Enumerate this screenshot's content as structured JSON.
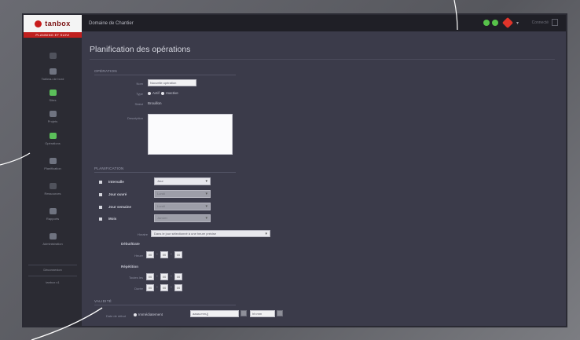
{
  "brand": {
    "logo_text": "tanbox",
    "tagline": "PLANNING ET SUIVI"
  },
  "topbar": {
    "app_title": "Domaine de Chantier",
    "user_name": "Connecté",
    "status_caret": "▾"
  },
  "sidebar": {
    "items": [
      {
        "label": "Tableau de bord",
        "icon": "dashboard-icon"
      },
      {
        "label": "Sites",
        "icon": "site-icon"
      },
      {
        "label": "Projets",
        "icon": "projects-icon"
      },
      {
        "label": "Opérations",
        "icon": "operations-icon"
      },
      {
        "label": "Planification",
        "icon": "planning-icon"
      },
      {
        "label": "Ressources",
        "icon": "resources-icon"
      },
      {
        "label": "Rapports",
        "icon": "reports-icon"
      },
      {
        "label": "Administration",
        "icon": "admin-icon"
      },
      {
        "label": "Déconnexion",
        "icon": "logout-icon"
      }
    ],
    "footer": "tanbox v1"
  },
  "page": {
    "title": "Planification des opérations",
    "section_operation": {
      "heading": "OPÉRATION",
      "name_label": "Nom",
      "name_value": "Nouvelle opération",
      "type_label": "Type",
      "type_options": [
        "Actif",
        "Inactive"
      ],
      "status_label": "Statut",
      "status_value": "Brouillon",
      "description_label": "Description",
      "description_value": ""
    },
    "section_schedule": {
      "heading": "PLANIFICATION",
      "rows": [
        {
          "label": "Intervalle",
          "value": "Jour",
          "disabled": false
        },
        {
          "label": "Jour ouvré",
          "value": "Lundi",
          "disabled": true
        },
        {
          "label": "Jour semaine",
          "value": "Lundi",
          "disabled": true
        },
        {
          "label": "Mois",
          "value": "Janvier",
          "disabled": true
        }
      ],
      "time_label": "Horaire",
      "time_value": "Dans le jour sélectionné à une heure précise",
      "start_heading": "Début/Date",
      "start_label": "Heure",
      "start_values": [
        "00",
        "00",
        "00"
      ],
      "end_heading": "Répétition",
      "end_label1": "Toutes les",
      "end_label2": "Durée",
      "end_values1": [
        "00",
        "00",
        "00"
      ],
      "end_values2": [
        "00",
        "00",
        "00"
      ]
    },
    "section_validity": {
      "heading": "VALIDITÉ",
      "label": "Date de début",
      "option": "Immédiatement",
      "date_value": "aaaa-mm-jj",
      "time_value": "hh:mm"
    }
  },
  "colors": {
    "brand_red": "#c0201f",
    "status_green": "#57c24a",
    "alert_red": "#e0342a"
  }
}
